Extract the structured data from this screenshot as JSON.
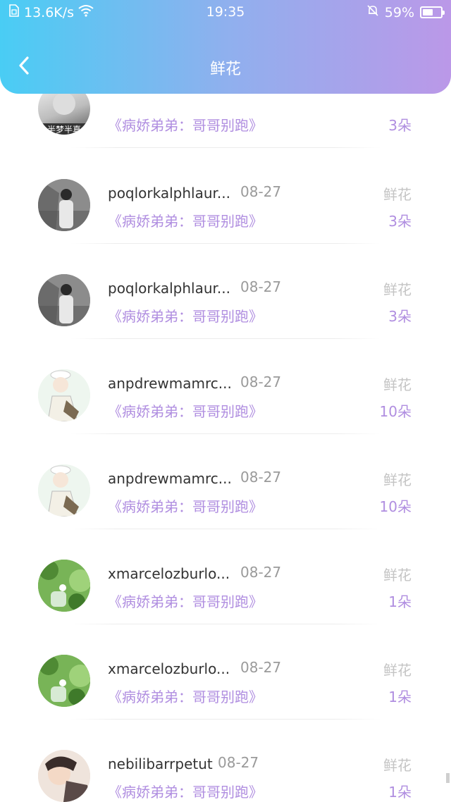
{
  "status_bar": {
    "network_speed": "13.6K/s",
    "time": "19:35",
    "battery": "59%",
    "battery_level": 0.59
  },
  "header": {
    "title": "鲜花",
    "back_icon": "chevron-left-icon"
  },
  "items": [
    {
      "name": "",
      "date": "",
      "gift": "",
      "book": "《病娇弟弟：哥哥别跑》",
      "count": "3朵",
      "avatar_caption": "半梦半真"
    },
    {
      "name": "poqlorkalphlaur...",
      "date": "08-27",
      "gift": "鲜花",
      "book": "《病娇弟弟：哥哥别跑》",
      "count": "3朵"
    },
    {
      "name": "poqlorkalphlaur...",
      "date": "08-27",
      "gift": "鲜花",
      "book": "《病娇弟弟：哥哥别跑》",
      "count": "3朵"
    },
    {
      "name": "anpdrewmamrc...",
      "date": "08-27",
      "gift": "鲜花",
      "book": "《病娇弟弟：哥哥别跑》",
      "count": "10朵"
    },
    {
      "name": "anpdrewmamrc...",
      "date": "08-27",
      "gift": "鲜花",
      "book": "《病娇弟弟：哥哥别跑》",
      "count": "10朵"
    },
    {
      "name": "xmarcelozburlo...",
      "date": "08-27",
      "gift": "鲜花",
      "book": "《病娇弟弟：哥哥别跑》",
      "count": "1朵"
    },
    {
      "name": "xmarcelozburlo...",
      "date": "08-27",
      "gift": "鲜花",
      "book": "《病娇弟弟：哥哥别跑》",
      "count": "1朵"
    },
    {
      "name": "nebilibarrpetut",
      "date": "08-27",
      "gift": "鲜花",
      "book": "《病娇弟弟：哥哥别跑》",
      "count": "1朵"
    }
  ]
}
